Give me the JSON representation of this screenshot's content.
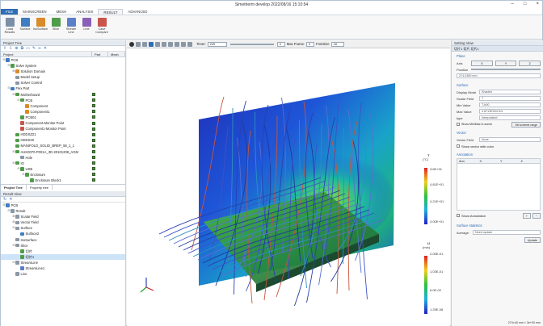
{
  "window": {
    "title": "Simetherm develop 2022/08/16 15:10:54",
    "controls": [
      "–",
      "□",
      "×"
    ]
  },
  "menu": {
    "tabs": [
      "FILE",
      "MAINSCREEN",
      "MESH",
      "ANALYSIS",
      "RESULT",
      "ADVANCED"
    ],
    "active": "RESULT"
  },
  "ribbon": {
    "buttons": [
      {
        "label": "Load Results",
        "icon": "load-results-icon",
        "color": "#7a8fa6"
      },
      {
        "label": "Surface",
        "icon": "surface-icon",
        "color": "#3f7cc1"
      },
      {
        "label": "IsoSurface",
        "icon": "isosurface-icon",
        "color": "#d98a2b"
      },
      {
        "label": "Slice",
        "icon": "slice-icon",
        "color": "#4f9c4a"
      },
      {
        "label": "Stream Line",
        "icon": "streamline-icon",
        "color": "#5b7fc8"
      },
      {
        "label": "Line",
        "icon": "line-icon",
        "color": "#8a5fb7"
      },
      {
        "label": "Case Compare",
        "icon": "case-compare-icon",
        "color": "#c9554b"
      }
    ]
  },
  "project_tree": {
    "title": "Project Tree",
    "columns": [
      "Project",
      "Part",
      "Mesh"
    ],
    "rows": [
      {
        "label": "PCB",
        "depth": 0,
        "icon": "#3f7cc1",
        "exp": "⊟",
        "chk": false
      },
      {
        "label": "Solve System",
        "depth": 1,
        "icon": "#4f9c4a",
        "exp": "⊟",
        "chk": false
      },
      {
        "label": "Solution Domain",
        "depth": 2,
        "icon": "#d98a2b",
        "exp": "⊞",
        "chk": false
      },
      {
        "label": "Model Setup",
        "depth": 2,
        "icon": "#8a97a6",
        "exp": "",
        "chk": false
      },
      {
        "label": "Solver Control",
        "depth": 2,
        "icon": "#8a97a6",
        "exp": "",
        "chk": false
      },
      {
        "label": "Flex Part",
        "depth": 1,
        "icon": "#3f7cc1",
        "exp": "⊟",
        "chk": false
      },
      {
        "label": "Motherboard",
        "depth": 2,
        "icon": "#4f9c4a",
        "exp": "⊟",
        "chk": true
      },
      {
        "label": "PCB",
        "depth": 3,
        "icon": "#4f9c4a",
        "exp": "⊟",
        "chk": true
      },
      {
        "label": "Component",
        "depth": 4,
        "icon": "#d98a2b",
        "exp": "",
        "chk": true
      },
      {
        "label": "Component1",
        "depth": 4,
        "icon": "#d98a2b",
        "exp": "",
        "chk": true
      },
      {
        "label": "PCB01",
        "depth": 3,
        "icon": "#4f9c4a",
        "exp": "",
        "chk": true
      },
      {
        "label": "Component-Monitor Point",
        "depth": 3,
        "icon": "#c9554b",
        "exp": "",
        "chk": true
      },
      {
        "label": "Component1-Monitor Point",
        "depth": 3,
        "icon": "#c9554b",
        "exp": "",
        "chk": true
      },
      {
        "label": "HDDSZ21",
        "depth": 2,
        "icon": "#4f9c4a",
        "exp": "",
        "chk": true
      },
      {
        "label": "HDDS40",
        "depth": 2,
        "icon": "#4f9c4a",
        "exp": "",
        "chk": true
      },
      {
        "label": "MANIFOLD_SOLID_BREP_58_1_1",
        "depth": 2,
        "icon": "#4f9c4a",
        "exp": "",
        "chk": true
      },
      {
        "label": "AUK0070-P001A_3D-20101208_AGM",
        "depth": 2,
        "icon": "#4f9c4a",
        "exp": "⊟",
        "chk": true
      },
      {
        "label": "Hole",
        "depth": 3,
        "icon": "#8a97a6",
        "exp": "",
        "chk": true
      },
      {
        "label": "IO",
        "depth": 2,
        "icon": "#4f9c4a",
        "exp": "⊟",
        "chk": true
      },
      {
        "label": "USB",
        "depth": 3,
        "icon": "#4f9c4a",
        "exp": "⊟",
        "chk": true
      },
      {
        "label": "Enclosure",
        "depth": 4,
        "icon": "#4f9c4a",
        "exp": "⊟",
        "chk": true
      },
      {
        "label": "Enclosure Block1",
        "depth": 5,
        "icon": "#4f9c4a",
        "exp": "",
        "chk": true
      }
    ],
    "tabs": [
      "Project Tree",
      "Property tree"
    ]
  },
  "result_view": {
    "title": "Result View",
    "rows": [
      {
        "label": "PCB",
        "depth": 0,
        "icon": "#3f7cc1",
        "exp": "⊟",
        "sel": false
      },
      {
        "label": "Result",
        "depth": 1,
        "icon": "#8a97a6",
        "exp": "⊟",
        "sel": false
      },
      {
        "label": "Scalar Field",
        "depth": 2,
        "icon": "#8a97a6",
        "exp": "⊞",
        "sel": false
      },
      {
        "label": "Vector Field",
        "depth": 2,
        "icon": "#8a97a6",
        "exp": "⊞",
        "sel": false
      },
      {
        "label": "Surface",
        "depth": 2,
        "icon": "#8a97a6",
        "exp": "⊟",
        "sel": false
      },
      {
        "label": "Surface2",
        "depth": 3,
        "icon": "#3f7cc1",
        "exp": "",
        "sel": false
      },
      {
        "label": "IsoSurface",
        "depth": 2,
        "icon": "#8a97a6",
        "exp": "",
        "sel": false
      },
      {
        "label": "Slice",
        "depth": 2,
        "icon": "#8a97a6",
        "exp": "⊟",
        "sel": false
      },
      {
        "label": "切片",
        "depth": 3,
        "icon": "#4f9c4a",
        "exp": "",
        "sel": false
      },
      {
        "label": "切片1",
        "depth": 3,
        "icon": "#4f9c4a",
        "exp": "",
        "sel": true
      },
      {
        "label": "StreamLine",
        "depth": 2,
        "icon": "#8a97a6",
        "exp": "⊟",
        "sel": false
      },
      {
        "label": "StreamLine1",
        "depth": 3,
        "icon": "#5b7fc8",
        "exp": "",
        "sel": false
      },
      {
        "label": "Line",
        "depth": 2,
        "icon": "#8a97a6",
        "exp": "",
        "sel": false
      }
    ]
  },
  "viewport": {
    "timer_label": "Timer:",
    "timer_value": "225",
    "frame_value": "0",
    "max_frame_label": "Max Frame:",
    "max_frame_value": "0",
    "fontsize_label": "FontSize",
    "fontsize_value": "18",
    "legend_temp": {
      "title": "T",
      "unit": "(°C)",
      "labels": [
        "3.6E+01",
        "4.81E+01",
        "4.21E+01",
        "3.00E+01"
      ]
    },
    "legend_vel": {
      "title": "U",
      "unit": "(m/s)",
      "labels": [
        "2.05E-01",
        "1.03E-01",
        "6.0E-02",
        "1.25E-08"
      ]
    }
  },
  "setting_view": {
    "title": "Setting View",
    "subtitle": "切片1  切片   切片1",
    "plane_label": "Plane",
    "axis_label": "Axis",
    "axis_options": [
      "X",
      "Y",
      "Z"
    ],
    "position_label": "Position",
    "position_value": "274.0389 mm",
    "surface_label": "Surface",
    "display_mode_label": "Display Mode",
    "display_mode_value": "Shaded",
    "scalar_field_label": "Scalar Field",
    "scalar_field_value": "T",
    "min_value_label": "Min Value",
    "min_value_value": "T-b00",
    "max_value_label": "Max Value",
    "max_value_value": "4.8713E004 K/s",
    "type_label": "type",
    "type_value": "Interpolated",
    "show_minmax_label": "Show Min/Max in scene",
    "set_scheme_label": "Set scheme range",
    "vector_label": "Vector",
    "vector_field_label": "Vector Field",
    "vector_field_value": "None",
    "show_vector_label": "Show vector with color",
    "annotation_label": "Annotation",
    "annotation_columns": [
      "Ann",
      "X",
      "Y",
      "Z"
    ],
    "show_annotation_label": "Show Annotation",
    "surface_stats_label": "Surface statistics",
    "average_label": "Average:",
    "average_value": "Need update",
    "update_label": "Update"
  },
  "status": {
    "text": "274×40 mm × 3e+00 mm"
  }
}
